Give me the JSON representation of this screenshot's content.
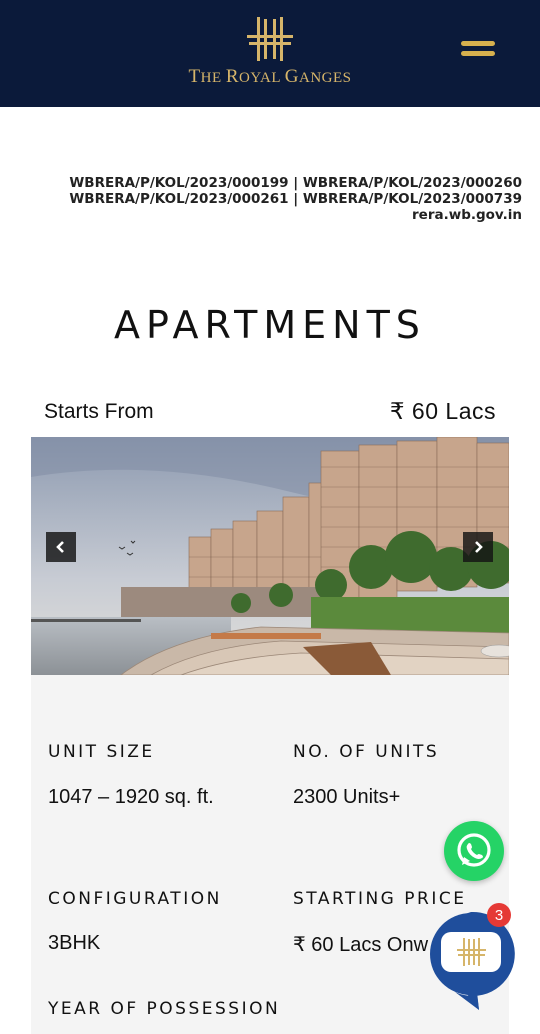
{
  "header": {
    "logo_text_first": "T",
    "logo_text_rest": "HE ",
    "logo_text_r": "R",
    "logo_text_oyal": "OYAL ",
    "logo_text_g": "G",
    "logo_text_anges": "ANGES",
    "logo_text": "THE ROYAL GANGES",
    "menu_icon": "hamburger-menu-icon"
  },
  "rera": {
    "line1": "WBRERA/P/KOL/2023/000199 | WBRERA/P/KOL/2023/000260",
    "line2": "WBRERA/P/KOL/2023/000261 | WBRERA/P/KOL/2023/000739",
    "line3": "rera.wb.gov.in"
  },
  "page_title": "APARTMENTS",
  "pricing": {
    "starts_label": "Starts From",
    "price": "₹ 60 Lacs"
  },
  "carousel": {
    "prev_icon": "chevron-left-icon",
    "next_icon": "chevron-right-icon"
  },
  "details": {
    "unit_size_label": "UNIT SIZE",
    "unit_size_value": "1047 – 1920 sq. ft.",
    "units_label": "NO. OF UNITS",
    "units_value": "2300 Units+",
    "config_label": "CONFIGURATION",
    "config_value": "3BHK",
    "starting_price_label": "STARTING PRICE",
    "starting_price_value": "₹ 60 Lacs Onw",
    "possession_label": "YEAR OF POSSESSION"
  },
  "chat": {
    "badge_count": "3",
    "whatsapp_icon": "whatsapp-icon",
    "chat_icon": "chat-bubble-icon"
  },
  "colors": {
    "header_bg": "#0b1a3a",
    "gold": "#d6b56a",
    "whatsapp": "#25d366",
    "badge": "#e53935",
    "chat_blue": "#1f4e9c"
  }
}
